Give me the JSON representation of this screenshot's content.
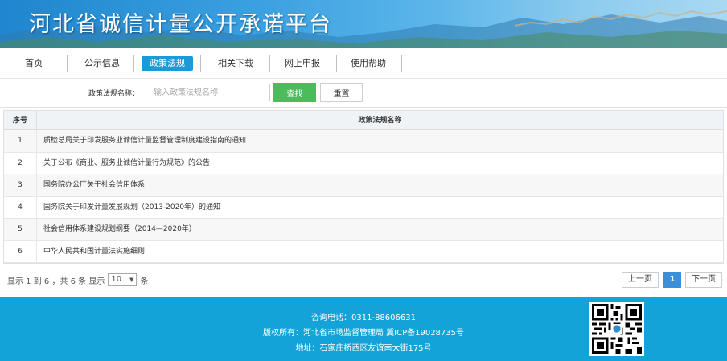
{
  "banner": {
    "title": "河北省诚信计量公开承诺平台"
  },
  "nav": {
    "items": [
      "首页",
      "公示信息",
      "政策法规",
      "相关下载",
      "网上申报",
      "使用帮助"
    ],
    "active_index": 2
  },
  "search": {
    "label": "政策法规名称：",
    "placeholder": "输入政策法规名称",
    "find_label": "查找",
    "reset_label": "重置"
  },
  "table": {
    "headers": [
      "序号",
      "政策法规名称"
    ],
    "rows": [
      {
        "no": "1",
        "name": "质检总局关于印发服务业诚信计量监督管理制度建设指南的通知"
      },
      {
        "no": "2",
        "name": "关于公布《商业、服务业诚信计量行为规范》的公告"
      },
      {
        "no": "3",
        "name": "国务院办公厅关于社会信用体系"
      },
      {
        "no": "4",
        "name": "国务院关于印发计量发展规划（2013-2020年）的通知"
      },
      {
        "no": "5",
        "name": "社会信用体系建设规划纲要（2014—2020年）"
      },
      {
        "no": "6",
        "name": "中华人民共和国计量法实施细则"
      }
    ]
  },
  "pager": {
    "info_prefix": "显示 1 到 6 ，共 6 条  显示",
    "page_size": "10",
    "info_suffix": "条",
    "prev": "上一页",
    "current": "1",
    "next": "下一页"
  },
  "footer": {
    "phone": "咨询电话：0311-88606631",
    "copyright": "版权所有：河北省市场监督管理局 冀ICP备19028735号",
    "address": "地址：石家庄桥西区友谊南大街175号"
  }
}
